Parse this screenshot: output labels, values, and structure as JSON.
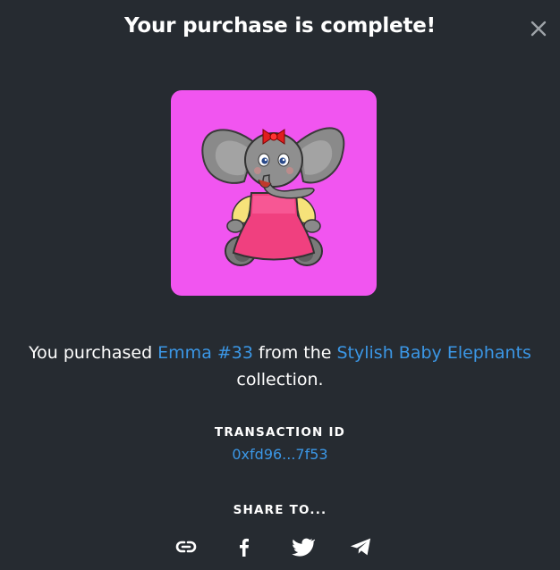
{
  "dialog": {
    "title": "Your purchase is complete!",
    "close_icon": "close-icon"
  },
  "nft": {
    "image_icon": "elephant-illustration",
    "background_color": "#f155f0"
  },
  "purchase": {
    "prefix": "You purchased ",
    "item_name": "Emma #33",
    "middle": " from the ",
    "collection_name": "Stylish Baby Elephants",
    "suffix": "collection."
  },
  "transaction": {
    "label": "TRANSACTION ID",
    "id": "0xfd96...7f53"
  },
  "share": {
    "label": "SHARE TO...",
    "buttons": [
      {
        "icon": "link-icon"
      },
      {
        "icon": "facebook-icon"
      },
      {
        "icon": "twitter-icon"
      },
      {
        "icon": "telegram-icon"
      }
    ]
  },
  "colors": {
    "background": "#262b31",
    "link": "#3b97e6",
    "text": "#ffffff"
  }
}
